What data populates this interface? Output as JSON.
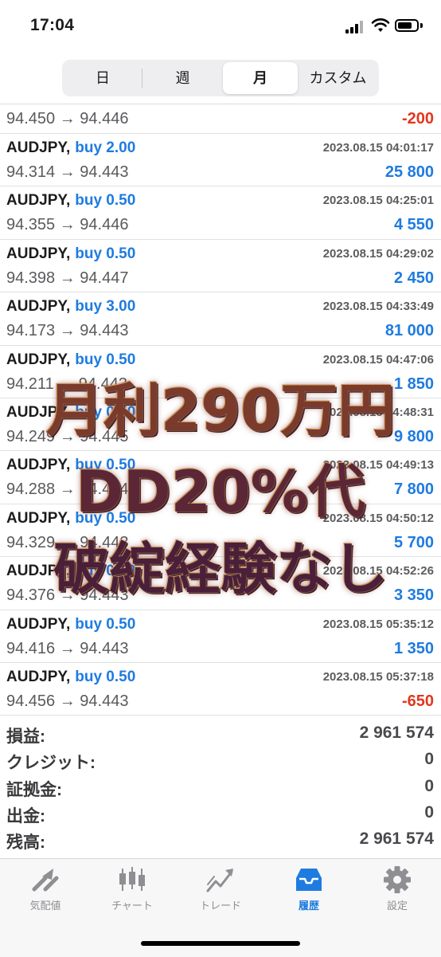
{
  "status": {
    "time": "17:04"
  },
  "period_tabs": [
    "日",
    "週",
    "月",
    "カスタム"
  ],
  "period_active": "月",
  "deals": [
    {
      "symbol": "",
      "side": "",
      "datetime": "",
      "prices": "94.450 → 94.446",
      "profit": "-200",
      "negative": true
    },
    {
      "symbol": "AUDJPY,",
      "side": "buy 2.00",
      "datetime": "2023.08.15 04:01:17",
      "prices": "94.314 → 94.443",
      "profit": "25 800",
      "negative": false
    },
    {
      "symbol": "AUDJPY,",
      "side": "buy 0.50",
      "datetime": "2023.08.15 04:25:01",
      "prices": "94.355 → 94.446",
      "profit": "4 550",
      "negative": false
    },
    {
      "symbol": "AUDJPY,",
      "side": "buy 0.50",
      "datetime": "2023.08.15 04:29:02",
      "prices": "94.398 → 94.447",
      "profit": "2 450",
      "negative": false
    },
    {
      "symbol": "AUDJPY,",
      "side": "buy 3.00",
      "datetime": "2023.08.15 04:33:49",
      "prices": "94.173 → 94.443",
      "profit": "81 000",
      "negative": false
    },
    {
      "symbol": "AUDJPY,",
      "side": "buy 0.50",
      "datetime": "2023.08.15 04:47:06",
      "prices": "94.211 → 94.443",
      "profit": "1 850",
      "negative": false
    },
    {
      "symbol": "AUDJPY,",
      "side": "buy 0.50",
      "datetime": "2023.08.15 04:48:31",
      "prices": "94.249 → 94.445",
      "profit": "9 800",
      "negative": false
    },
    {
      "symbol": "AUDJPY,",
      "side": "buy 0.50",
      "datetime": "2023.08.15 04:49:13",
      "prices": "94.288 → 94.444",
      "profit": "7 800",
      "negative": false
    },
    {
      "symbol": "AUDJPY,",
      "side": "buy 0.50",
      "datetime": "2023.08.15 04:50:12",
      "prices": "94.329 → 94.443",
      "profit": "5 700",
      "negative": false
    },
    {
      "symbol": "AUDJPY,",
      "side": "buy 0.50",
      "datetime": "2023.08.15 04:52:26",
      "prices": "94.376 → 94.443",
      "profit": "3 350",
      "negative": false
    },
    {
      "symbol": "AUDJPY,",
      "side": "buy 0.50",
      "datetime": "2023.08.15 05:35:12",
      "prices": "94.416 → 94.443",
      "profit": "1 350",
      "negative": false
    },
    {
      "symbol": "AUDJPY,",
      "side": "buy 0.50",
      "datetime": "2023.08.15 05:37:18",
      "prices": "94.456 → 94.443",
      "profit": "-650",
      "negative": true
    }
  ],
  "summary": [
    {
      "label": "損益:",
      "value": "2 961 574"
    },
    {
      "label": "クレジット:",
      "value": "0"
    },
    {
      "label": "証拠金:",
      "value": "0"
    },
    {
      "label": "出金:",
      "value": "0"
    },
    {
      "label": "残高:",
      "value": "2 961 574"
    }
  ],
  "overlay": [
    "月利290万円",
    "DD20%代",
    "破綻経験なし"
  ],
  "tabbar": [
    {
      "label": "気配値",
      "icon": "quotes-icon",
      "active": false
    },
    {
      "label": "チャート",
      "icon": "chart-icon",
      "active": false
    },
    {
      "label": "トレード",
      "icon": "trade-icon",
      "active": false
    },
    {
      "label": "履歴",
      "icon": "history-icon",
      "active": true
    },
    {
      "label": "設定",
      "icon": "settings-icon",
      "active": false
    }
  ],
  "colors": {
    "accent": "#1e7be0",
    "loss": "#e0371f"
  }
}
